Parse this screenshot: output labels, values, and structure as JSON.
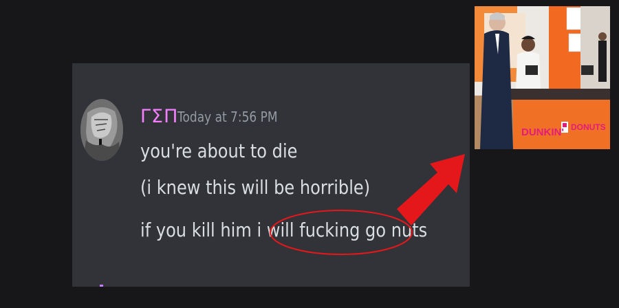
{
  "message": {
    "username": "ΓΣΠ",
    "timestamp": "Today at 7:56 PM",
    "lines": [
      "you're about to die",
      "(i knew this will be horrible)",
      "if you kill him i will fucking go nuts"
    ]
  },
  "photo": {
    "sign_left": "DUNKIN'",
    "sign_right": "DONUTS"
  },
  "colors": {
    "background": "#17171a",
    "panel": "#313338",
    "username": "#f47fff",
    "timestamp": "#949ba4",
    "message_text": "#dbdee1",
    "annotation": "#e4181b"
  }
}
